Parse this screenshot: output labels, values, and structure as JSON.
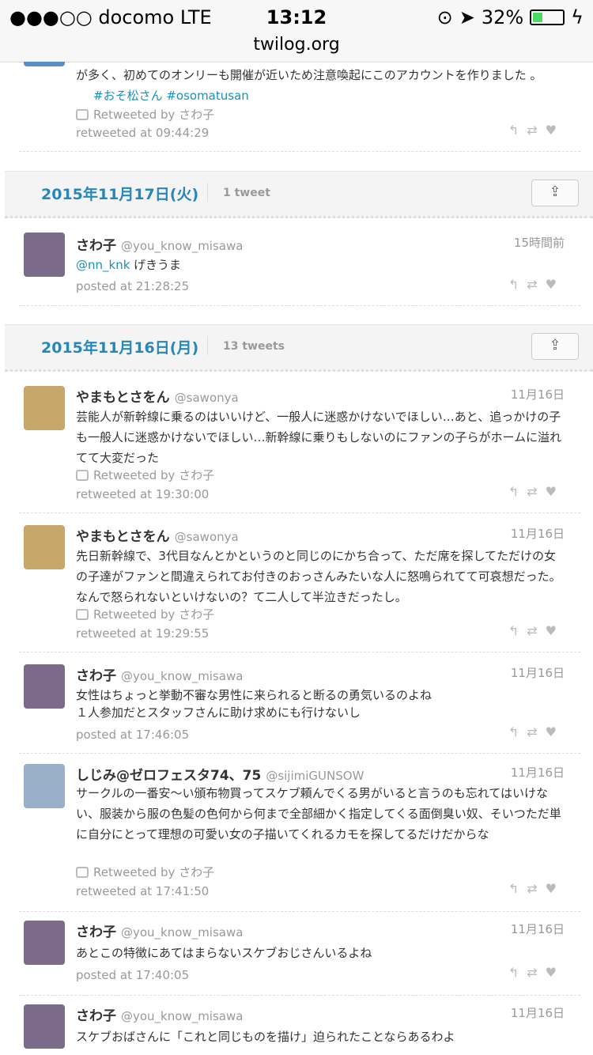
{
  "status_bar": {
    "carrier": "●●●○○ docomo  LTE",
    "time": "13:12",
    "battery": "32%",
    "battery_level": 0.32
  },
  "url": "twilog.org",
  "top_tweet": {
    "text": "が多く、初めてのオンリーも開催が近いため注意喚起にこのアカウントを作りました 。",
    "hashtags": "#おそ松さん #osomatusan",
    "retweeted_by": "Retweeted by さわ子",
    "meta": "retweeted at 09:44:29"
  },
  "days": [
    {
      "date": "2015年11月17日(火)",
      "count": "1 tweet",
      "share_icon": "share-icon",
      "tweets": [
        {
          "name": "さわ子",
          "handle": "@you_know_misawa",
          "time": "15時間前",
          "mention": "@nn_knk",
          "text": " げきうま",
          "meta": "posted at 21:28:25"
        }
      ]
    },
    {
      "date": "2015年11月16日(月)",
      "count": "13 tweets",
      "share_icon": "share-icon",
      "tweets": [
        {
          "name": "やまもとさをん",
          "handle": "@sawonya",
          "time": "11月16日",
          "text": "芸能人が新幹線に乗るのはいいけど、一般人に迷惑かけないでほしい…あと、追っかけの子も一般人に迷惑かけないでほしい…新幹線に乗りもしないのにファンの子らがホームに溢れてて大変だった",
          "retweeted_by": "Retweeted by さわ子",
          "meta": "retweeted at 19:30:00"
        },
        {
          "name": "やまもとさをん",
          "handle": "@sawonya",
          "time": "11月16日",
          "text": "先日新幹線で、3代目なんとかというのと同じのにかち合って、ただ席を探してただけの女の子達がファンと間違えられてお付きのおっさんみたいな人に怒鳴られてて可哀想だった。なんで怒られないといけないの？て二人して半泣きだったし。",
          "retweeted_by": "Retweeted by さわ子",
          "meta": "retweeted at 19:29:55"
        },
        {
          "name": "さわ子",
          "handle": "@you_know_misawa",
          "time": "11月16日",
          "text": "女性はちょっと挙動不審な男性に来られると断るの勇気いるのよね\n１人参加だとスタッフさんに助け求めにも行けないし",
          "meta": "posted at 17:46:05"
        },
        {
          "name": "しじみ@ゼロフェスタ74、75",
          "handle": "@sijimiGUNSOW",
          "time": "11月16日",
          "text": "サークルの一番安〜い頒布物買ってスケブ頼んでくる男がいると言うのも忘れてはいけない、服装から服の色髪の色何から何まで全部細かく指定してくる面倒臭い奴、そいつただ単に自分にとって理想の可愛い女の子描いてくれるカモを探してるだけだからな",
          "retweeted_by": "Retweeted by さわ子",
          "meta": "retweeted at 17:41:50"
        },
        {
          "name": "さわ子",
          "handle": "@you_know_misawa",
          "time": "11月16日",
          "text": "あとこの特徴にあてはまらないスケブおじさんいるよね",
          "meta": "posted at 17:40:05"
        },
        {
          "name": "さわ子",
          "handle": "@you_know_misawa",
          "time": "11月16日",
          "text": "スケブおばさんに「これと同じものを描け」迫られたことならあるわよ"
        }
      ]
    }
  ],
  "action_icons": [
    "reply-icon",
    "retweet-icon",
    "favorite-icon"
  ],
  "colors": {
    "link": "#1a8fb8",
    "date": "#2787b7",
    "battery": "#4cd964"
  }
}
